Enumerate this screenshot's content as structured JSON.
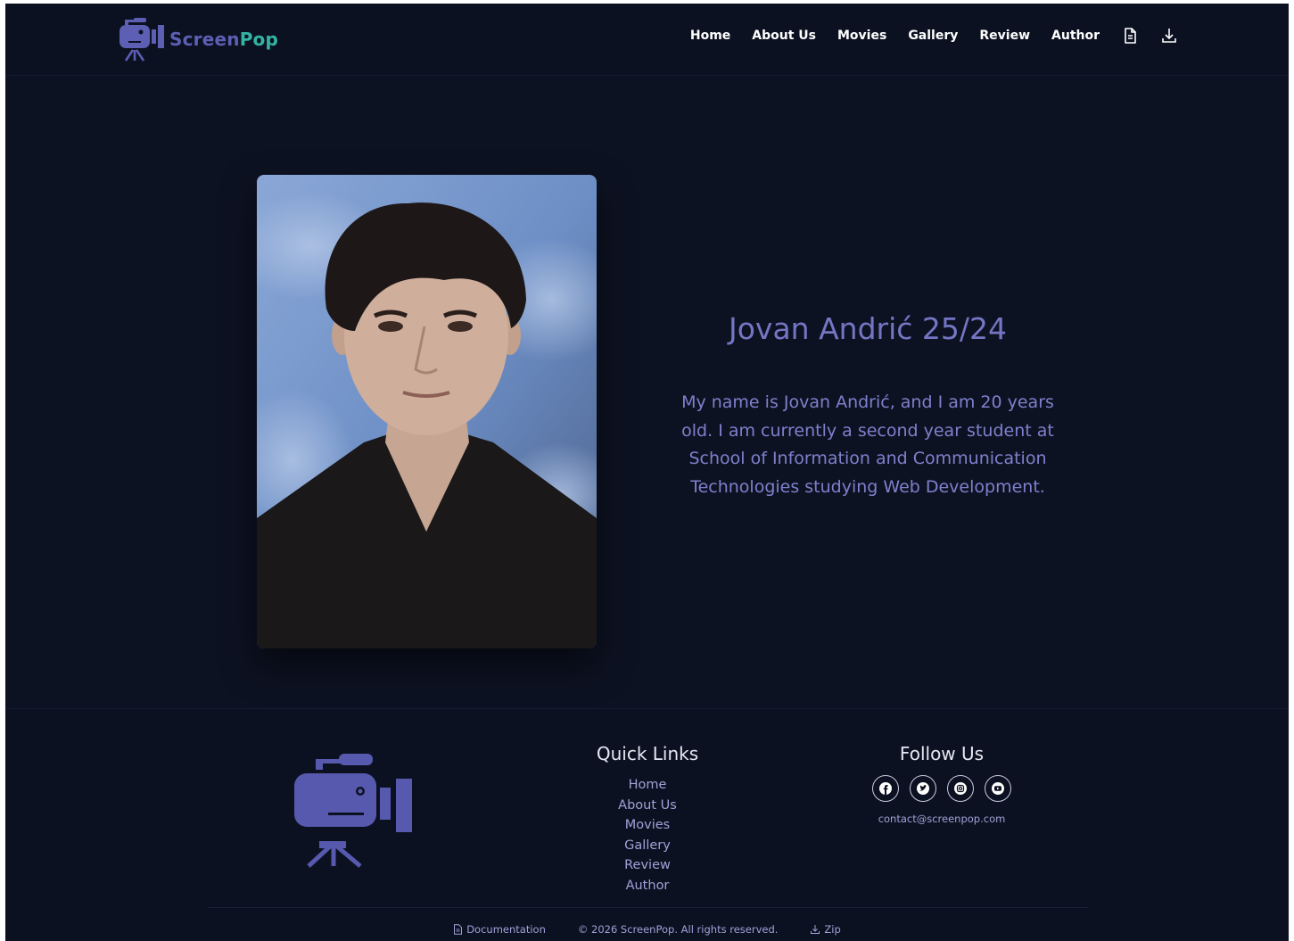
{
  "brand": {
    "name_part1": "Screen",
    "name_part2": "Pop"
  },
  "nav": {
    "items": [
      "Home",
      "About Us",
      "Movies",
      "Gallery",
      "Review",
      "Author"
    ],
    "icons": [
      "document-icon",
      "download-icon"
    ]
  },
  "author": {
    "name": "Jovan Andrić 25/24",
    "bio": "My name is Jovan Andrić, and I am 20 years old. I am currently a second year student at School of Information and Communication Technologies studying Web Development."
  },
  "footer": {
    "quick_links_title": "Quick Links",
    "quick_links": [
      "Home",
      "About Us",
      "Movies",
      "Gallery",
      "Review",
      "Author"
    ],
    "follow_title": "Follow Us",
    "socials": [
      "facebook-icon",
      "twitter-icon",
      "instagram-icon",
      "youtube-icon"
    ],
    "contact": "contact@screenpop.com",
    "bottom": {
      "documentation": "Documentation",
      "copyright": "© 2026 ScreenPop. All rights reserved.",
      "zip": "Zip"
    }
  },
  "colors": {
    "background": "#0d1222",
    "accent": "#5c5fb3",
    "brand_teal": "#34b5a3",
    "text_light": "#9ea2d8"
  }
}
